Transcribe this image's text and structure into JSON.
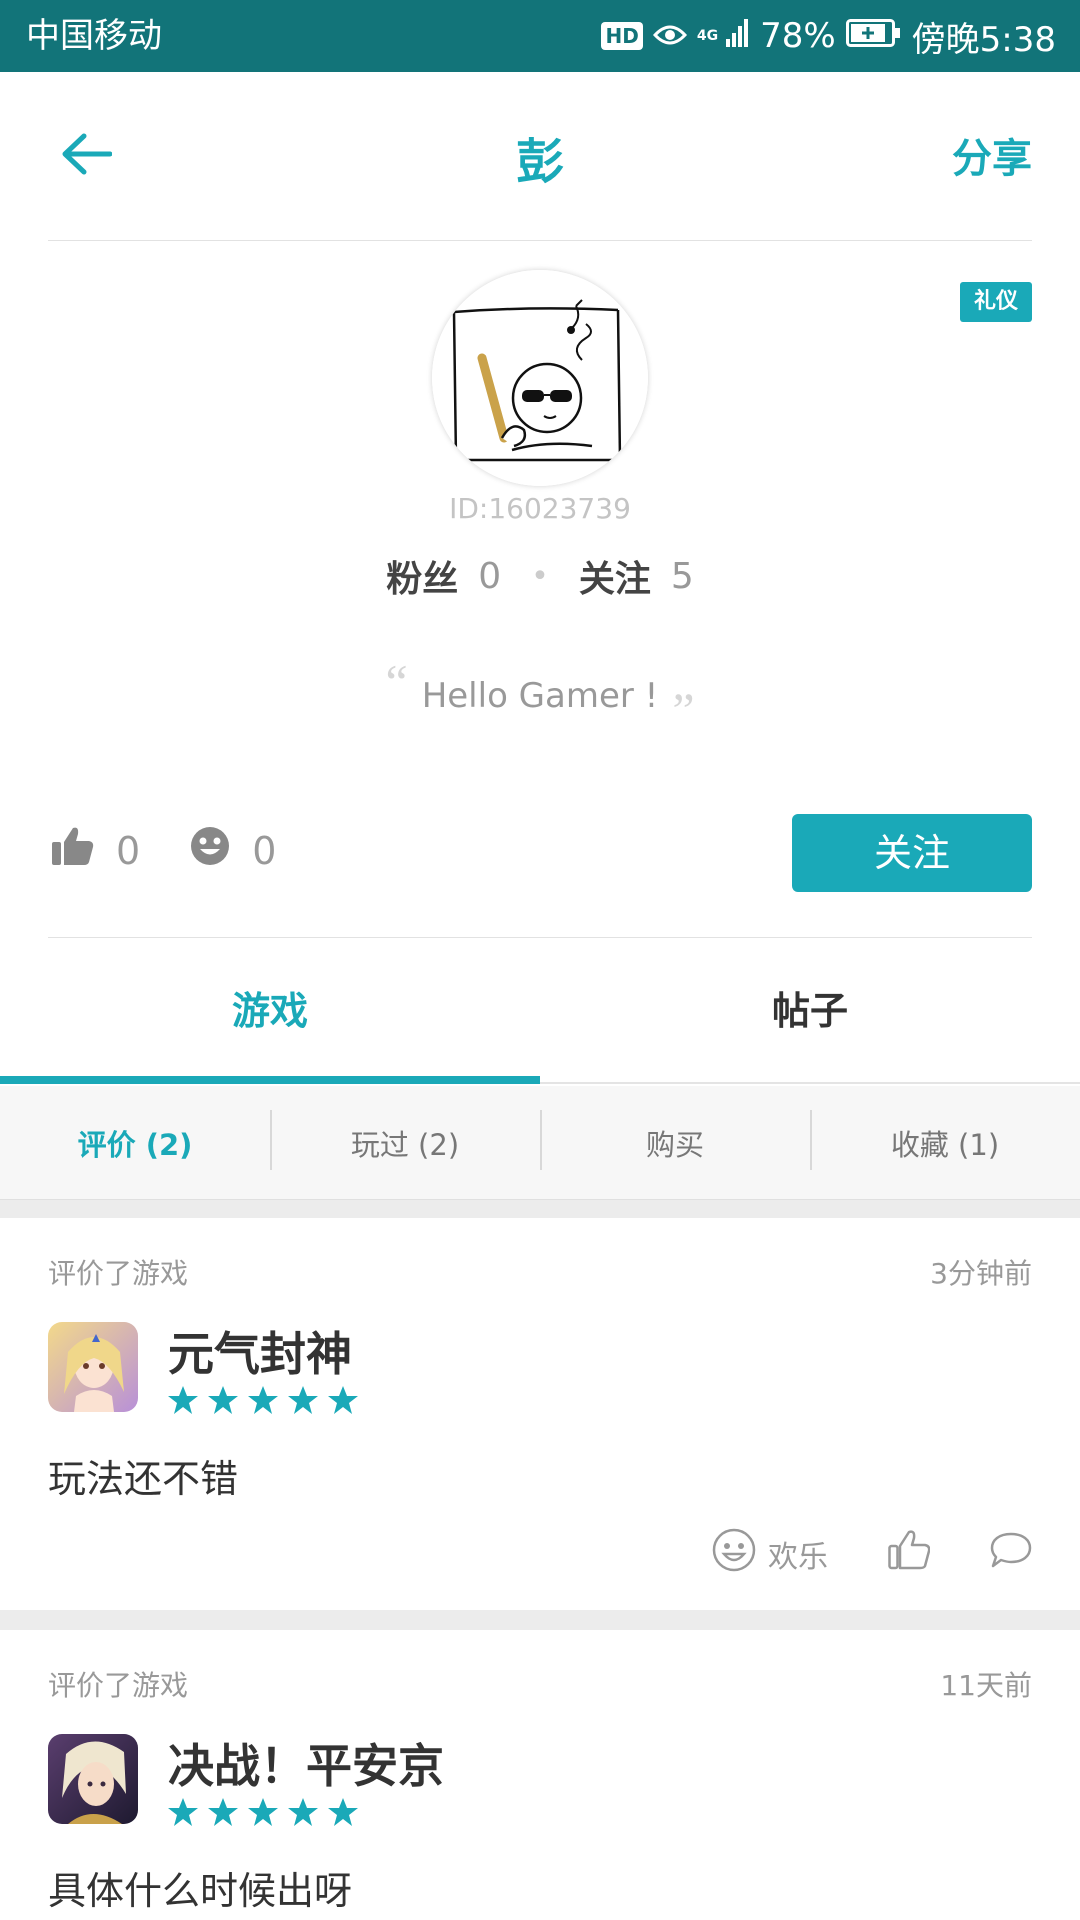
{
  "status_bar": {
    "carrier": "中国移动",
    "hd": "HD",
    "network": "4G",
    "battery_percent": "78%",
    "time": "傍晚5:38"
  },
  "header": {
    "title": "彭",
    "share_label": "分享"
  },
  "profile": {
    "badge": "礼仪",
    "user_id": "ID:16023739",
    "fans_label": "粉丝",
    "fans_count": "0",
    "following_label": "关注",
    "following_count": "5",
    "quote_open": "“",
    "signature": "Hello Gamer !",
    "quote_close": "”",
    "likes": "0",
    "fun": "0",
    "follow_button": "关注"
  },
  "tabs": [
    {
      "label": "游戏",
      "active": true
    },
    {
      "label": "帖子",
      "active": false
    }
  ],
  "subtabs": [
    {
      "label": "评价 (2)",
      "active": true
    },
    {
      "label": "玩过 (2)",
      "active": false
    },
    {
      "label": "购买",
      "active": false
    },
    {
      "label": "收藏 (1)",
      "active": false
    }
  ],
  "reviews": [
    {
      "meta": "评价了游戏",
      "time": "3分钟前",
      "game": "元气封神",
      "rating": 5,
      "text": "玩法还不错",
      "reaction_label": "欢乐"
    },
    {
      "meta": "评价了游戏",
      "time": "11天前",
      "game": "决战！平安京",
      "rating": 5,
      "text": "具体什么时候出呀"
    }
  ],
  "colors": {
    "accent": "#1aa9b8",
    "status_bar": "#127479"
  },
  "icons": {
    "back": "arrow-left-icon",
    "like": "thumb-up-icon",
    "fun": "smiley-icon",
    "star": "star-icon",
    "comment": "chat-bubble-icon"
  }
}
